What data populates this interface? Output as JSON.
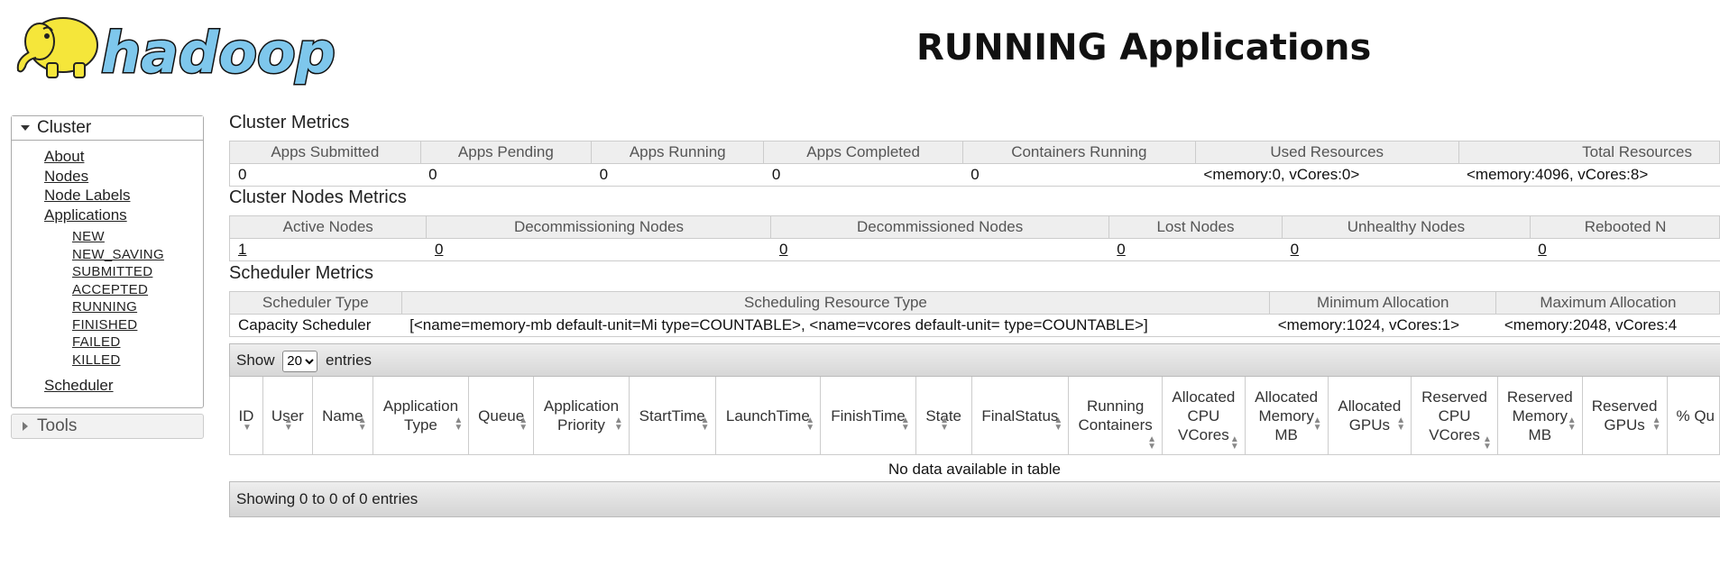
{
  "header": {
    "logo_text": "hadoop",
    "title": "RUNNING Applications"
  },
  "nav": {
    "cluster_label": "Cluster",
    "links": [
      "About",
      "Nodes",
      "Node Labels",
      "Applications"
    ],
    "app_states": [
      "NEW",
      "NEW_SAVING",
      "SUBMITTED",
      "ACCEPTED",
      "RUNNING",
      "FINISHED",
      "FAILED",
      "KILLED"
    ],
    "scheduler": "Scheduler",
    "tools_label": "Tools"
  },
  "cluster_metrics": {
    "title": "Cluster Metrics",
    "headers": [
      "Apps Submitted",
      "Apps Pending",
      "Apps Running",
      "Apps Completed",
      "Containers Running",
      "Used Resources",
      "Total Resources"
    ],
    "values": [
      "0",
      "0",
      "0",
      "0",
      "0",
      "<memory:0, vCores:0>",
      "<memory:4096, vCores:8>"
    ]
  },
  "node_metrics": {
    "title": "Cluster Nodes Metrics",
    "headers": [
      "Active Nodes",
      "Decommissioning Nodes",
      "Decommissioned Nodes",
      "Lost Nodes",
      "Unhealthy Nodes",
      "Rebooted N"
    ],
    "values": [
      "1",
      "0",
      "0",
      "0",
      "0",
      "0"
    ]
  },
  "scheduler_metrics": {
    "title": "Scheduler Metrics",
    "headers": [
      "Scheduler Type",
      "Scheduling Resource Type",
      "Minimum Allocation",
      "Maximum Allocation"
    ],
    "values": [
      "Capacity Scheduler",
      "[<name=memory-mb default-unit=Mi type=COUNTABLE>, <name=vcores default-unit= type=COUNTABLE>]",
      "<memory:1024, vCores:1>",
      "<memory:2048, vCores:4"
    ]
  },
  "apps_table": {
    "show_label": "Show",
    "page_size": "20",
    "entries_label": "entries",
    "columns": [
      "ID",
      "User",
      "Name",
      "Application Type",
      "Queue",
      "Application Priority",
      "StartTime",
      "LaunchTime",
      "FinishTime",
      "State",
      "FinalStatus",
      "Running Containers",
      "Allocated CPU VCores",
      "Allocated Memory MB",
      "Allocated GPUs",
      "Reserved CPU VCores",
      "Reserved Memory MB",
      "Reserved GPUs",
      "% Qu"
    ],
    "empty_message": "No data available in table",
    "footer": "Showing 0 to 0 of 0 entries"
  },
  "colors": {
    "logo_yellow": "#f5e63a",
    "logo_blue": "#7ec7ec",
    "header_gray": "#eeeeee"
  }
}
